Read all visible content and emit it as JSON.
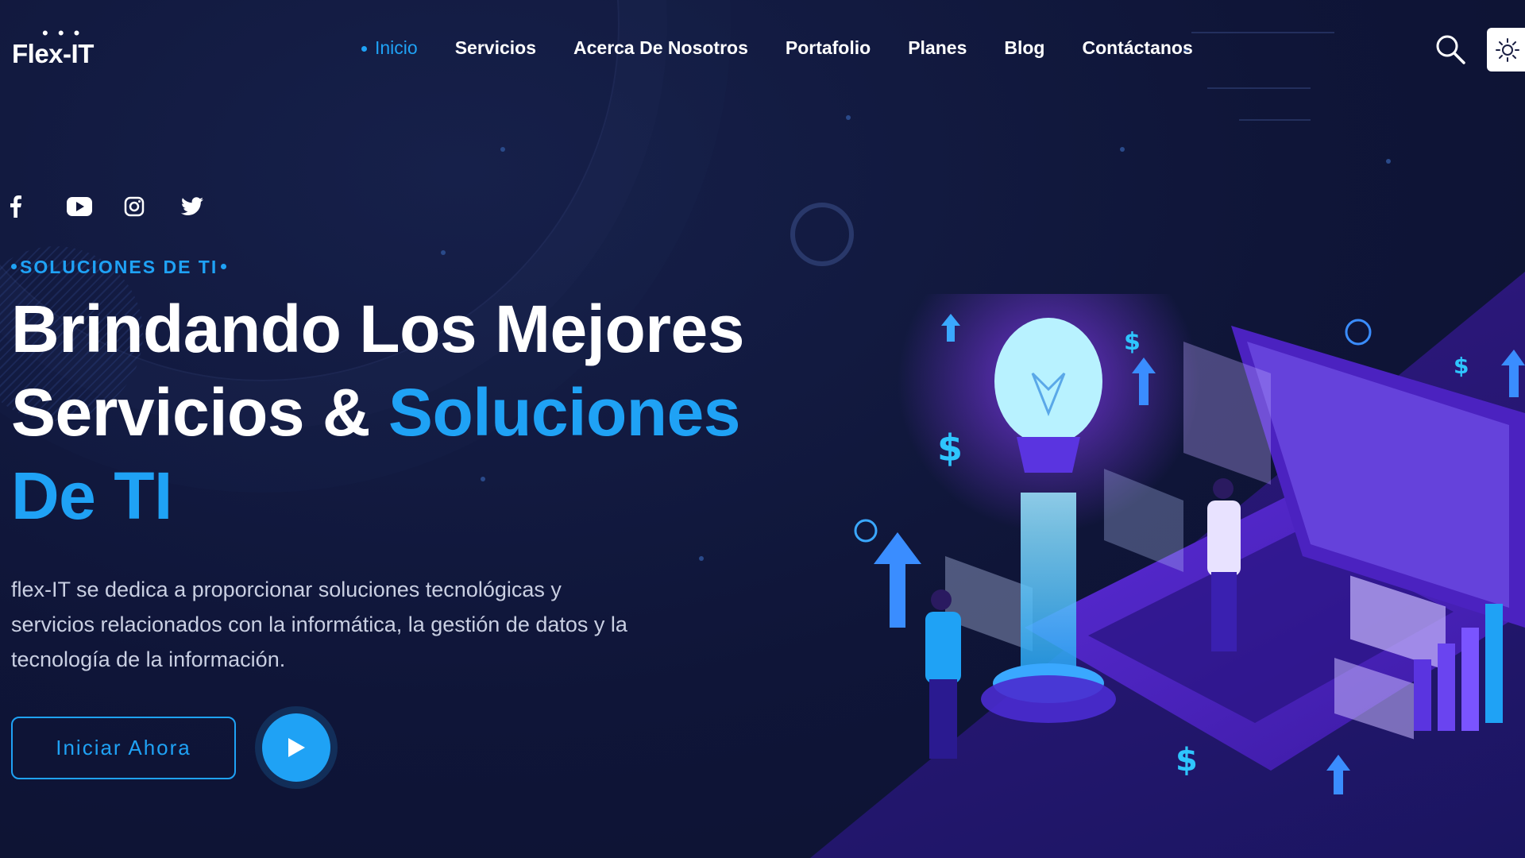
{
  "header": {
    "logo_text": "Flex-IT",
    "logo_dots": "• • •",
    "nav": [
      {
        "label": "Inicio",
        "active": true
      },
      {
        "label": "Servicios",
        "active": false
      },
      {
        "label": "Acerca De Nosotros",
        "active": false
      },
      {
        "label": "Portafolio",
        "active": false
      },
      {
        "label": "Planes",
        "active": false
      },
      {
        "label": "Blog",
        "active": false
      },
      {
        "label": "Contáctanos",
        "active": false
      }
    ],
    "search_icon": "search-icon",
    "theme_icon": "sun-icon"
  },
  "social": [
    "facebook-icon",
    "youtube-icon",
    "instagram-icon",
    "twitter-icon"
  ],
  "hero": {
    "eyebrow": "SOLUCIONES DE TI",
    "headline_line1": "Brindando Los Mejores",
    "headline_line2_white": "Servicios & ",
    "headline_line2_accent": "Soluciones",
    "headline_line3_accent": "De TI",
    "description": "flex-IT se dedica a proporcionar soluciones tecnológicas y servicios relacionados con la informática, la gestión de datos y la tecnología de la información.",
    "cta_label": "Iniciar Ahora",
    "play_icon": "play-icon"
  },
  "colors": {
    "background": "#0f1538",
    "accent": "#1fa2f5",
    "purple": "#3b1c9a",
    "text": "#ffffff"
  }
}
